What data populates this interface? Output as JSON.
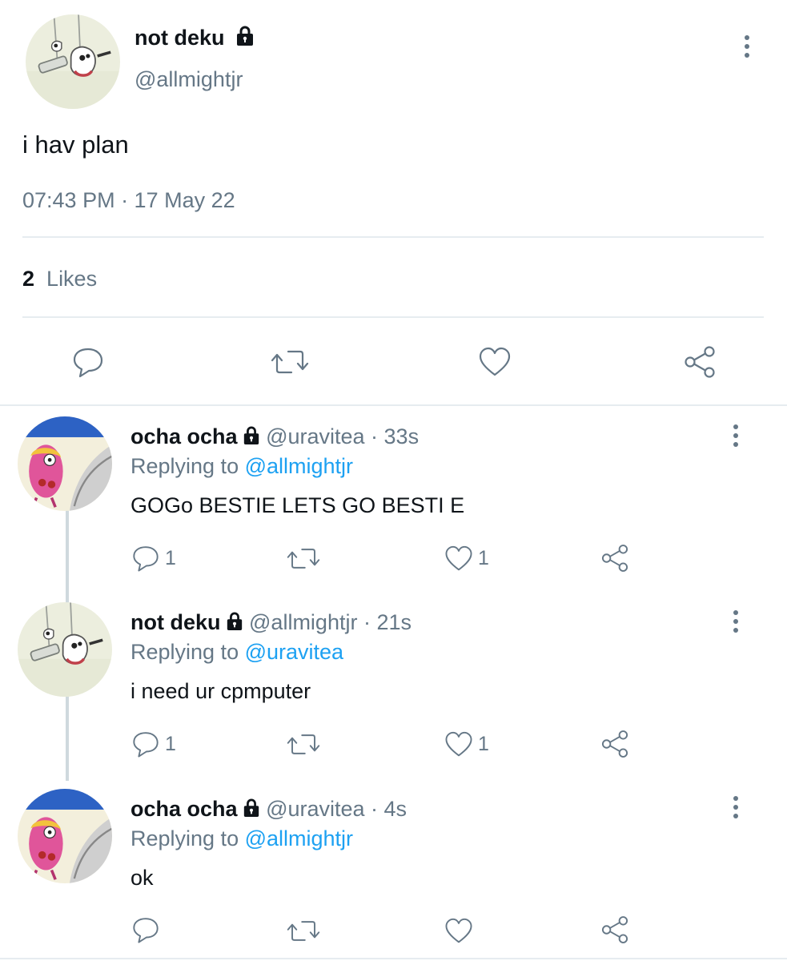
{
  "main_tweet": {
    "author_name": "not deku",
    "author_handle": "@allmightjr",
    "protected_icon": "lock-icon",
    "text": "i hav plan",
    "timestamp": "07:43 PM · 17 May 22",
    "likes_count": "2",
    "likes_label": "Likes"
  },
  "actions": {
    "reply_icon": "reply-icon",
    "retweet_icon": "retweet-icon",
    "like_icon": "heart-icon",
    "share_icon": "share-icon",
    "more_icon": "more-vertical-icon"
  },
  "replies": [
    {
      "author_name": "ocha ocha",
      "author_handle": "@uravitea",
      "age": "· 33s",
      "replying_prefix": "Replying to",
      "replying_to": "@allmightjr",
      "text": "GOGo BESTIE LETS GO BESTI E",
      "reply_count": "1",
      "like_count": "1"
    },
    {
      "author_name": "not deku",
      "author_handle": "@allmightjr",
      "age": "· 21s",
      "replying_prefix": "Replying to",
      "replying_to": "@uravitea",
      "text": "i need ur cpmputer",
      "reply_count": "1",
      "like_count": "1"
    },
    {
      "author_name": "ocha ocha",
      "author_handle": "@uravitea",
      "age": "· 4s",
      "replying_prefix": "Replying to",
      "replying_to": "@allmightjr",
      "text": "ok",
      "reply_count": "",
      "like_count": ""
    }
  ],
  "colors": {
    "text": "#0f1419",
    "secondary": "#657786",
    "link": "#1da1f2",
    "divider": "#e6ecf0"
  }
}
